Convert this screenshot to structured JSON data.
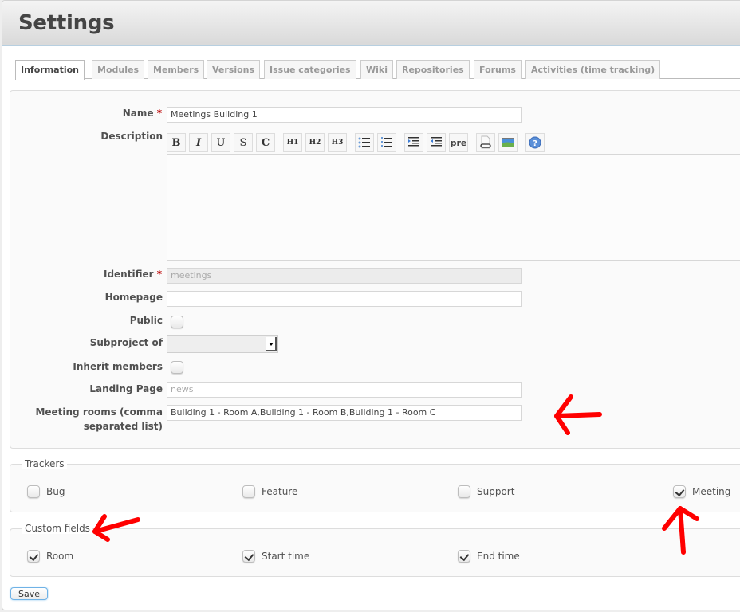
{
  "header": {
    "title": "Settings"
  },
  "tabs": [
    {
      "label": "Information",
      "selected": true
    },
    {
      "label": "Modules",
      "selected": false
    },
    {
      "label": "Members",
      "selected": false
    },
    {
      "label": "Versions",
      "selected": false
    },
    {
      "label": "Issue categories",
      "selected": false
    },
    {
      "label": "Wiki",
      "selected": false
    },
    {
      "label": "Repositories",
      "selected": false
    },
    {
      "label": "Forums",
      "selected": false
    },
    {
      "label": "Activities (time tracking)",
      "selected": false
    }
  ],
  "form": {
    "required_mark": "*",
    "name": {
      "label": "Name",
      "value": "Meetings Building 1"
    },
    "description": {
      "label": "Description",
      "value": "",
      "toolbar": [
        {
          "id": "bold",
          "glyph": "B"
        },
        {
          "id": "italic",
          "glyph": "I"
        },
        {
          "id": "underline",
          "glyph": "U"
        },
        {
          "id": "strikethrough",
          "glyph": "S"
        },
        {
          "id": "code",
          "glyph": "C"
        },
        {
          "id": "heading-1",
          "glyph": "H1"
        },
        {
          "id": "heading-2",
          "glyph": "H2"
        },
        {
          "id": "heading-3",
          "glyph": "H3"
        },
        {
          "id": "unordered-list",
          "glyph": ""
        },
        {
          "id": "ordered-list",
          "glyph": ""
        },
        {
          "id": "indent-right",
          "glyph": ""
        },
        {
          "id": "indent-left",
          "glyph": ""
        },
        {
          "id": "preformatted",
          "glyph": "pre"
        },
        {
          "id": "wiki-link",
          "glyph": ""
        },
        {
          "id": "image",
          "glyph": ""
        },
        {
          "id": "help",
          "glyph": "?"
        }
      ]
    },
    "identifier": {
      "label": "Identifier",
      "value": "meetings"
    },
    "homepage": {
      "label": "Homepage",
      "value": ""
    },
    "public": {
      "label": "Public",
      "checked": false
    },
    "subproject_of": {
      "label": "Subproject of",
      "selected": ""
    },
    "inherit_members": {
      "label": "Inherit members",
      "checked": false
    },
    "landing_page": {
      "label": "Landing Page",
      "placeholder": "news",
      "value": ""
    },
    "meeting_rooms": {
      "label_line1": "Meeting rooms (comma",
      "label_line2": "separated list)",
      "value": "Building 1 - Room A,Building 1 - Room B,Building 1 - Room C"
    }
  },
  "trackers": {
    "legend": "Trackers",
    "items": [
      {
        "label": "Bug",
        "checked": false
      },
      {
        "label": "Feature",
        "checked": false
      },
      {
        "label": "Support",
        "checked": false
      },
      {
        "label": "Meeting",
        "checked": true
      }
    ]
  },
  "custom_fields": {
    "legend": "Custom fields",
    "items": [
      {
        "label": "Room",
        "checked": true
      },
      {
        "label": "Start time",
        "checked": true
      },
      {
        "label": "End time",
        "checked": true
      }
    ]
  },
  "save_label": "Save",
  "annotation_color": "#ff0000"
}
